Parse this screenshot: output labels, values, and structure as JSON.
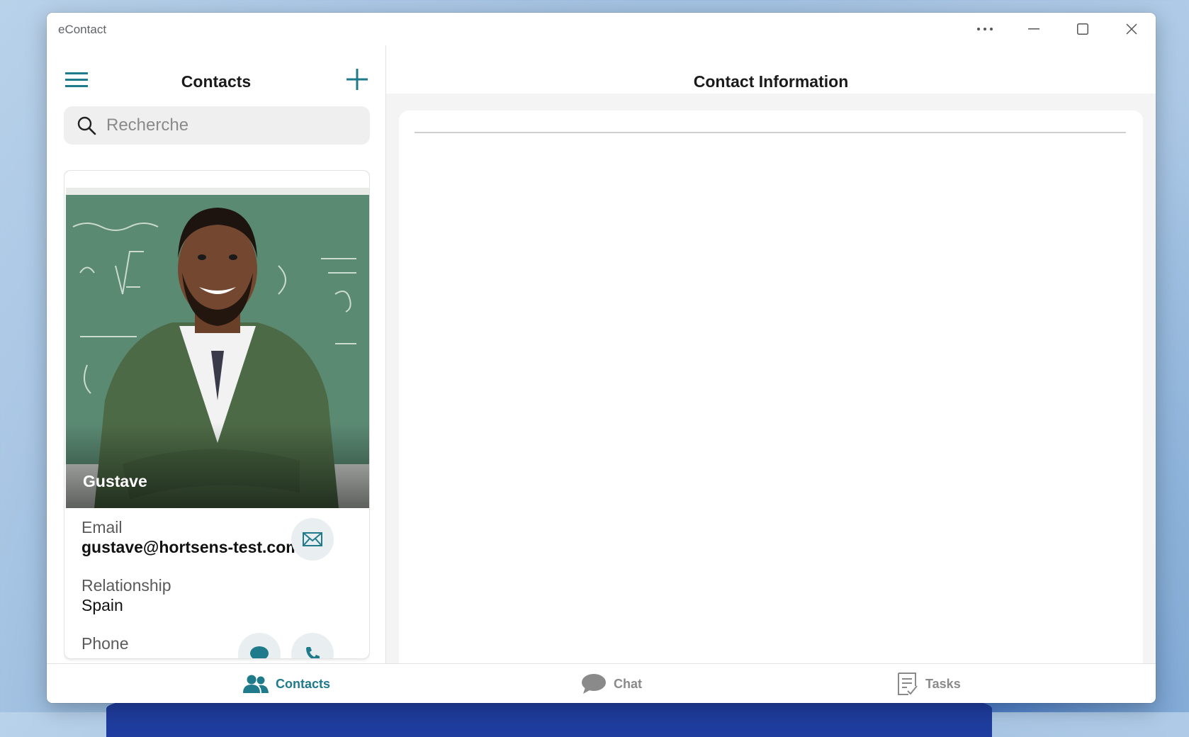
{
  "window": {
    "title": "eContact",
    "controls": [
      "more-icon",
      "minimize-icon",
      "maximize-icon",
      "close-icon"
    ]
  },
  "contacts_panel": {
    "title": "Contacts",
    "search": {
      "placeholder": "Recherche",
      "value": ""
    }
  },
  "contact_card": {
    "name": "Gustave",
    "email_label": "Email",
    "email": "gustave@hortsens-test.com",
    "relationship_label": "Relationship",
    "relationship": "Spain",
    "phone_label": "Phone"
  },
  "info_panel": {
    "title": "Contact Information"
  },
  "bottom_nav": {
    "items": [
      {
        "label": "Contacts",
        "icon": "people-icon",
        "active": true
      },
      {
        "label": "Chat",
        "icon": "chat-bubble-icon",
        "active": false
      },
      {
        "label": "Tasks",
        "icon": "tasks-checklist-icon",
        "active": false
      }
    ]
  },
  "colors": {
    "accent": "#1f7a8c",
    "inactive": "#8a8a8a",
    "button_bg": "#e9eef0"
  }
}
